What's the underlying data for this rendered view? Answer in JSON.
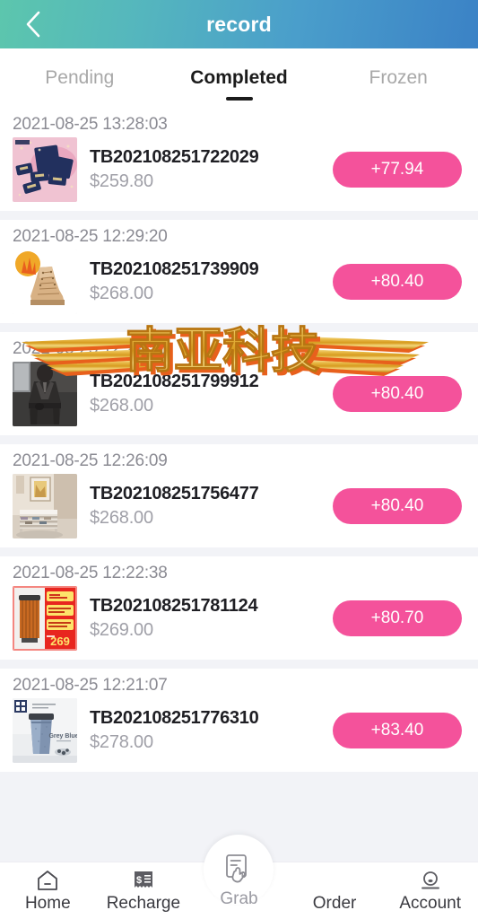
{
  "header": {
    "title": "record",
    "back_icon": "chevron-left-icon",
    "gradient_start": "#5cc6ad",
    "gradient_end": "#3b82c6"
  },
  "tabs": [
    {
      "label": "Pending",
      "active": false
    },
    {
      "label": "Completed",
      "active": true
    },
    {
      "label": "Frozen",
      "active": false
    }
  ],
  "watermark": {
    "text": "南亚科技",
    "color_gold": "#e0a830",
    "color_shadow": "#e8601c"
  },
  "colors": {
    "badge_pink": "#f4529b",
    "list_background": "#f2f3f7",
    "date_grey": "#8b8b93",
    "price_grey": "#a0a0a8"
  },
  "records": [
    {
      "datetime": "2021-08-25 13:28:03",
      "order_id": "TB202108251722029",
      "price": "$259.80",
      "commission": "+77.94",
      "thumb": "cosmetic-sachets-pink"
    },
    {
      "datetime": "2021-08-25 12:29:20",
      "order_id": "TB202108251739909",
      "price": "$268.00",
      "commission": "+80.40",
      "thumb": "tan-work-boot"
    },
    {
      "datetime": "2021-08-25 12:27:58",
      "order_id": "TB202108251799912",
      "price": "$268.00",
      "commission": "+80.40",
      "thumb": "dark-leather-jacket"
    },
    {
      "datetime": "2021-08-25 12:26:09",
      "order_id": "TB202108251756477",
      "price": "$268.00",
      "commission": "+80.40",
      "thumb": "white-shoe-rack-room"
    },
    {
      "datetime": "2021-08-25 12:22:38",
      "order_id": "TB202108251781124",
      "price": "$269.00",
      "commission": "+80.70",
      "thumb": "red-promo-oil-heater",
      "thumb_promo_price": "269"
    },
    {
      "datetime": "2021-08-25 12:21:07",
      "order_id": "TB202108251776310",
      "price": "$278.00",
      "commission": "+83.40",
      "thumb": "grey-blue-tumbler",
      "thumb_caption": "Grey Blue"
    }
  ],
  "bottom_nav": [
    {
      "label": "Home",
      "icon": "home-icon"
    },
    {
      "label": "Recharge",
      "icon": "receipt-dollar-icon"
    },
    {
      "label": "Grab",
      "icon": "hand-tap-card-icon",
      "center": true
    },
    {
      "label": "Order",
      "icon": ""
    },
    {
      "label": "Account",
      "icon": "person-icon"
    }
  ]
}
